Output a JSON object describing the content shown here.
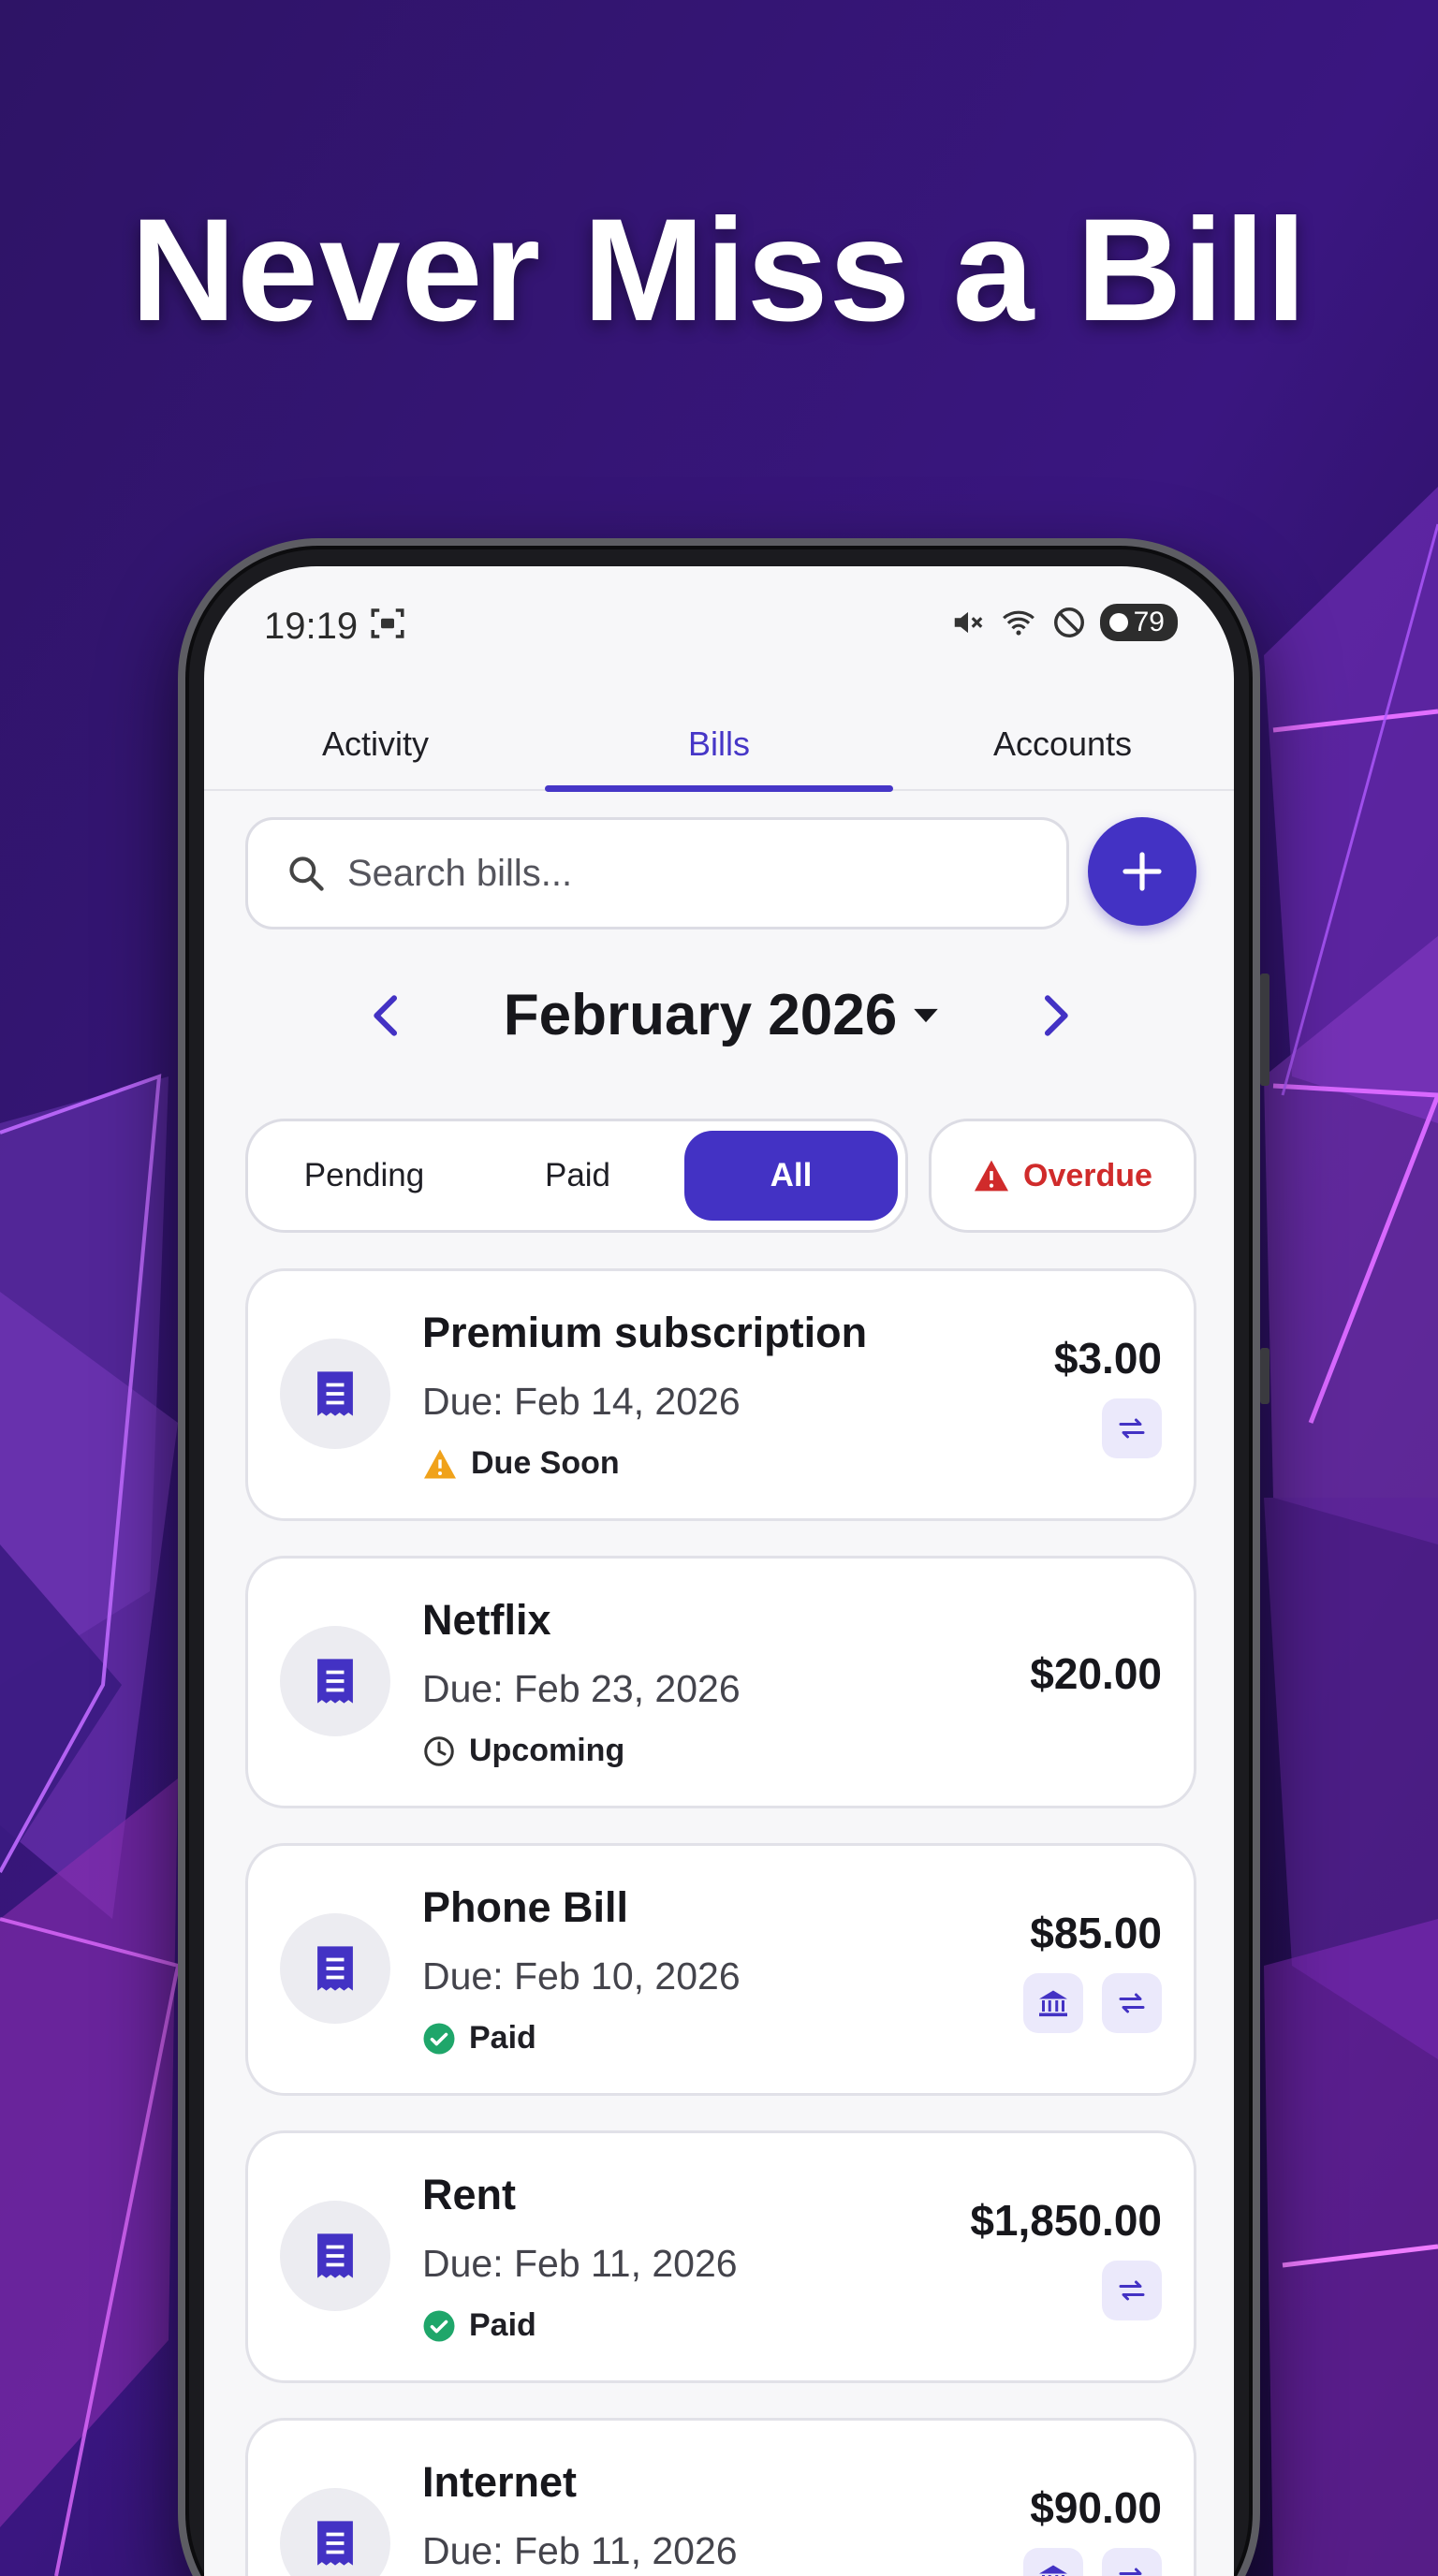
{
  "headline": "Never Miss a Bill",
  "colors": {
    "accent": "#4332c4",
    "overdue": "#d02b2b",
    "due_soon": "#f0a21b",
    "paid": "#1fa66a"
  },
  "status_bar": {
    "time": "19:19",
    "battery": "79"
  },
  "tabs": [
    {
      "label": "Activity"
    },
    {
      "label": "Bills",
      "active": true
    },
    {
      "label": "Accounts"
    }
  ],
  "search": {
    "placeholder": "Search bills..."
  },
  "month": {
    "label": "February 2026"
  },
  "filter": {
    "options": [
      {
        "label": "Pending"
      },
      {
        "label": "Paid"
      },
      {
        "label": "All",
        "selected": true
      }
    ],
    "overdue_label": "Overdue"
  },
  "bills": [
    {
      "name": "Premium subscription",
      "due": "Due: Feb 14, 2026",
      "status": "Due Soon",
      "status_icon": "warning-icon",
      "amount": "$3.00",
      "actions": [
        "repeat-icon"
      ]
    },
    {
      "name": "Netflix",
      "due": "Due: Feb 23, 2026",
      "status": "Upcoming",
      "status_icon": "clock-icon",
      "amount": "$20.00",
      "actions": []
    },
    {
      "name": "Phone Bill",
      "due": "Due: Feb 10, 2026",
      "status": "Paid",
      "status_icon": "check-circle-icon",
      "amount": "$85.00",
      "actions": [
        "bank-icon",
        "repeat-icon"
      ]
    },
    {
      "name": "Rent",
      "due": "Due: Feb 11, 2026",
      "status": "Paid",
      "status_icon": "check-circle-icon",
      "amount": "$1,850.00",
      "actions": [
        "repeat-icon"
      ]
    },
    {
      "name": "Internet",
      "due": "Due: Feb 11, 2026",
      "status": "",
      "status_icon": "",
      "amount": "$90.00",
      "actions": [
        "bank-icon",
        "repeat-icon"
      ]
    }
  ]
}
